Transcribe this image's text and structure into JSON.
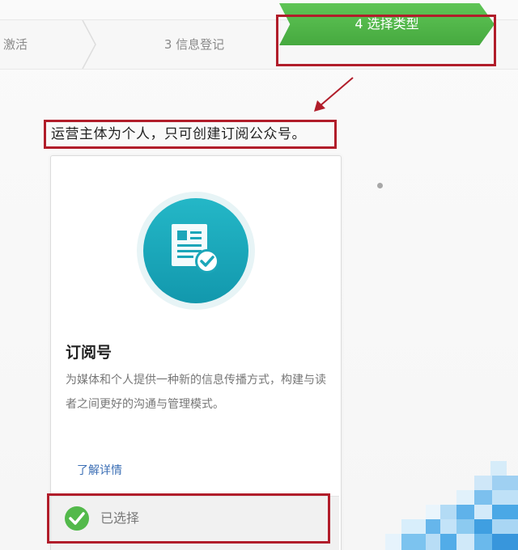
{
  "steps": {
    "step2_label": "激活",
    "step3_label": "3 信息登记",
    "step4_label": "4 选择类型"
  },
  "notice": {
    "text": "运营主体为个人，只可创建订阅公众号。"
  },
  "card": {
    "icon": "document-check-icon",
    "title": "订阅号",
    "description": "为媒体和个人提供一种新的信息传播方式，构建与读者之间更好的沟通与管理模式。",
    "learn_more": "了解详情",
    "selected_label": "已选择"
  },
  "colors": {
    "step_active": "#4caf45",
    "highlight": "#b11d2a",
    "icon_circle": "#1ba6b9",
    "link": "#3c6fb5",
    "check": "#53b94b"
  }
}
